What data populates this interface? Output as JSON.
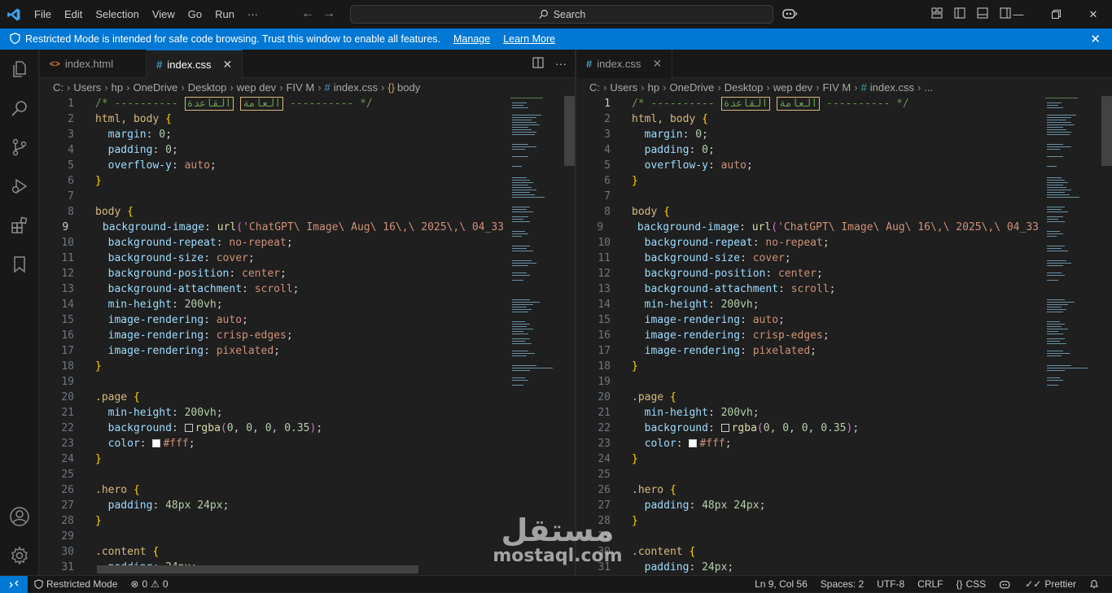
{
  "titlebar": {
    "menu": [
      "File",
      "Edit",
      "Selection",
      "View",
      "Go",
      "Run",
      "···"
    ],
    "search_placeholder": "Search"
  },
  "banner": {
    "message": "Restricted Mode is intended for safe code browsing. Trust this window to enable all features.",
    "manage": "Manage",
    "learn_more": "Learn More"
  },
  "left_editor": {
    "tabs": [
      {
        "label": "index.html",
        "icon": "html-file-icon"
      },
      {
        "label": "index.css",
        "icon": "css-file-icon"
      }
    ],
    "breadcrumb": [
      "C:",
      "Users",
      "hp",
      "OneDrive",
      "Desktop",
      "wep dev",
      "FIV M",
      "index.css",
      "body"
    ]
  },
  "right_editor": {
    "tabs": [
      {
        "label": "index.css",
        "icon": "css-file-icon"
      }
    ],
    "breadcrumb": [
      "C:",
      "Users",
      "hp",
      "OneDrive",
      "Desktop",
      "wep dev",
      "FIV M",
      "index.css",
      "..."
    ]
  },
  "code": {
    "arabic_word1": "العامة",
    "arabic_word2": "القاعدة",
    "bg_image_left": "'ChatGPT\\ Image\\ Aug\\ 16\\,\\ 2025\\,\\ 04_33",
    "bg_image_right": "'ChatGPT\\ Image\\ Aug\\ 16\\,\\ 2025\\,\\ 04_33"
  },
  "statusbar": {
    "restricted": "Restricted Mode",
    "errors": "0",
    "warnings": "0",
    "position": "Ln 9, Col 56",
    "spaces": "Spaces: 2",
    "encoding": "UTF-8",
    "eol": "CRLF",
    "language": "CSS",
    "formatter": "Prettier"
  },
  "watermark": {
    "arabic": "مستقل",
    "latin": "mostaql.com"
  },
  "colors": {
    "accent": "#0078d4",
    "background": "#1f1f1f",
    "sidebar": "#181818"
  }
}
